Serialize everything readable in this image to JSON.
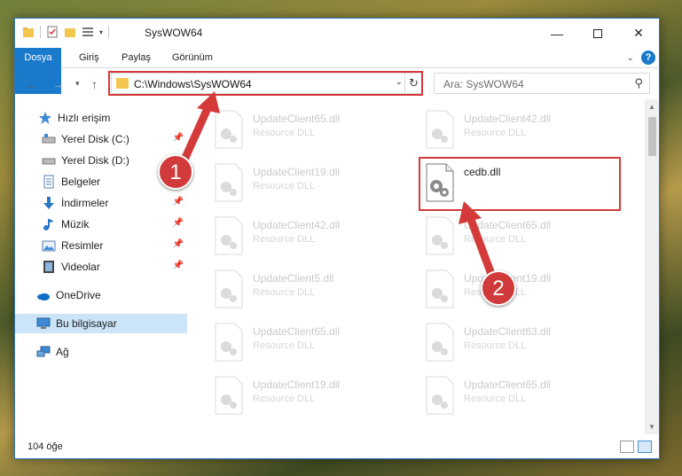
{
  "window": {
    "title": "SysWOW64"
  },
  "ribbon": {
    "tabs": [
      "Dosya",
      "Giriş",
      "Paylaş",
      "Görünüm"
    ]
  },
  "address": {
    "path": "C:\\Windows\\SysWOW64"
  },
  "search": {
    "placeholder": "Ara: SysWOW64"
  },
  "sidebar": {
    "items": [
      {
        "label": "Hızlı erişim",
        "icon": "star-icon"
      },
      {
        "label": "Yerel Disk (C:)",
        "icon": "drive-icon",
        "pinned": true
      },
      {
        "label": "Yerel Disk (D:)",
        "icon": "drive-icon"
      },
      {
        "label": "Belgeler",
        "icon": "document-icon",
        "pinned": true
      },
      {
        "label": "İndirmeler",
        "icon": "download-icon",
        "pinned": true
      },
      {
        "label": "Müzik",
        "icon": "music-icon",
        "pinned": true
      },
      {
        "label": "Resimler",
        "icon": "pictures-icon",
        "pinned": true
      },
      {
        "label": "Videolar",
        "icon": "video-icon",
        "pinned": true
      },
      {
        "label": "OneDrive",
        "icon": "cloud-icon"
      },
      {
        "label": "Bu bilgisayar",
        "icon": "computer-icon",
        "selected": true
      },
      {
        "label": "Ağ",
        "icon": "network-icon"
      }
    ]
  },
  "files": [
    {
      "name": "UpdateClient65.dll",
      "type": "Resource DLL"
    },
    {
      "name": "UpdateClient42.dll",
      "type": "Resource DLL"
    },
    {
      "name": "UpdateClient19.dll",
      "type": "Resource DLL"
    },
    {
      "name": "cedb.dll",
      "type": ""
    },
    {
      "name": "UpdateClient42.dll",
      "type": "Resource DLL"
    },
    {
      "name": "UpdateClient65.dll",
      "type": "Resource DLL"
    },
    {
      "name": "UpdateClient5.dll",
      "type": "Resource DLL"
    },
    {
      "name": "UpdateClient19.dll",
      "type": "Resource DLL"
    },
    {
      "name": "UpdateClient65.dll",
      "type": "Resource DLL"
    },
    {
      "name": "UpdateClient63.dll",
      "type": "Resource DLL"
    },
    {
      "name": "UpdateClient19.dll",
      "type": "Resource DLL"
    },
    {
      "name": "UpdateClient65.dll",
      "type": "Resource DLL"
    }
  ],
  "status": {
    "count": "104 öğe"
  },
  "annotations": {
    "step1": "1",
    "step2": "2"
  },
  "colors": {
    "accent": "#1979ca",
    "highlight": "#d43a3a",
    "selected": "#cce4f7"
  }
}
